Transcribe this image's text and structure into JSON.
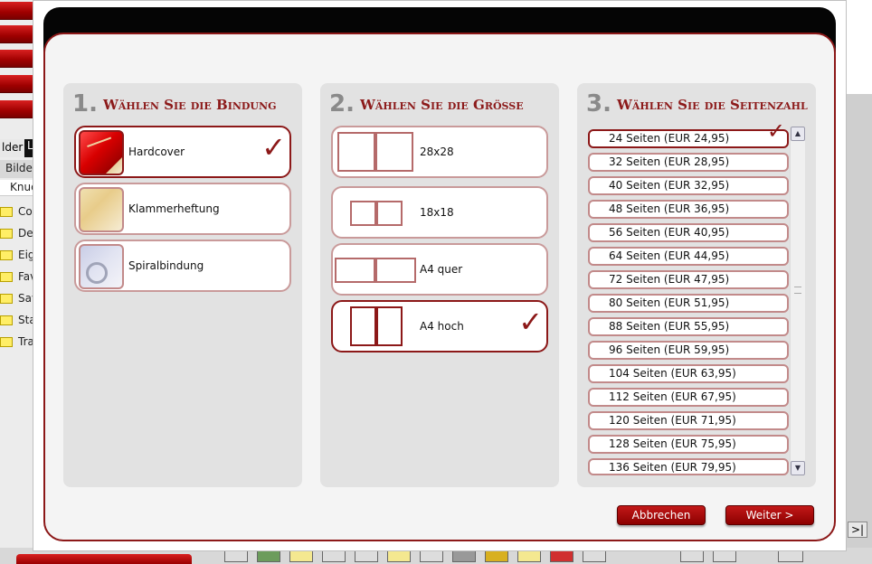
{
  "background": {
    "tabs": [
      "lder",
      "L"
    ],
    "breadcrumb": "Bilder",
    "input_value": "Knud",
    "folders": [
      "Coo",
      "De",
      "Eig",
      "Fav",
      "Sav",
      "Sta",
      "Tra"
    ],
    "right_button": ">|"
  },
  "steps": [
    {
      "number": "1.",
      "title": "Wählen Sie die Bindung",
      "options": [
        {
          "label": "Hardcover",
          "icon": "hardcover-thumb-icon",
          "selected": true
        },
        {
          "label": "Klammerheftung",
          "icon": "stapled-thumb-icon",
          "selected": false
        },
        {
          "label": "Spiralbindung",
          "icon": "spiral-thumb-icon",
          "selected": false
        }
      ]
    },
    {
      "number": "2.",
      "title": "Wählen Sie die Größe",
      "options": [
        {
          "label": "28x28",
          "selected": false
        },
        {
          "label": "18x18",
          "selected": false
        },
        {
          "label": "A4 quer",
          "selected": false
        },
        {
          "label": "A4 hoch",
          "selected": true
        }
      ]
    },
    {
      "number": "3.",
      "title": "Wählen Sie die Seitenzahl",
      "pages": [
        {
          "label": "24 Seiten (EUR 24,95)",
          "selected": true
        },
        {
          "label": "32 Seiten (EUR 28,95)"
        },
        {
          "label": "40 Seiten (EUR 32,95)"
        },
        {
          "label": "48 Seiten (EUR 36,95)"
        },
        {
          "label": "56 Seiten (EUR 40,95)"
        },
        {
          "label": "64 Seiten (EUR 44,95)"
        },
        {
          "label": "72 Seiten (EUR 47,95)"
        },
        {
          "label": "80 Seiten (EUR 51,95)"
        },
        {
          "label": "88 Seiten (EUR 55,95)"
        },
        {
          "label": "96 Seiten (EUR 59,95)"
        },
        {
          "label": "104 Seiten (EUR 63,95)"
        },
        {
          "label": "112 Seiten (EUR 67,95)"
        },
        {
          "label": "120 Seiten (EUR 71,95)"
        },
        {
          "label": "128 Seiten (EUR 75,95)"
        },
        {
          "label": "136 Seiten (EUR 79,95)"
        }
      ]
    }
  ],
  "check_mark": "✓",
  "buttons": {
    "cancel": "Abbrechen",
    "next": "Weiter >"
  },
  "colors": {
    "accent": "#8c1818",
    "panel": "#e2e2e2",
    "border_light": "#c28a8a"
  }
}
